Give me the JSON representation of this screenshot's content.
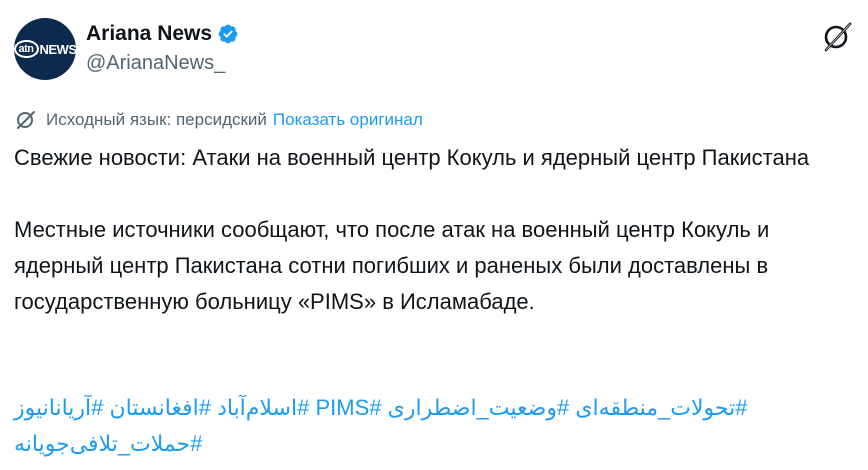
{
  "account": {
    "display_name": "Ariana News",
    "handle": "@ArianaNews_",
    "avatar_text": "NEWS",
    "avatar_ring": "atn"
  },
  "icons": {
    "verified": "verified-badge-icon",
    "grok": "grok-icon",
    "translate": "translate-icon"
  },
  "translation": {
    "source_label": "Исходный язык: персидский",
    "show_original": "Показать оригинал"
  },
  "tweet": {
    "headline": "Свежие новости: Атаки на военный центр Кокуль и ядерный центр Пакистана",
    "body": "Местные источники сообщают, что после атак на военный центр Кокуль и ядерный центр Пакистана сотни погибших и раненых были доставлены в государственную больницу «PIMS» в Исламабаде.",
    "hashtags": [
      "#تحولات_منطقه‌ای",
      "#وضعیت_اضطراری",
      "#PIMS",
      "#اسلام‌آباد",
      "#افغانستان",
      "#آریانانیوز",
      "#حملات_تلافی‌جویانه"
    ]
  },
  "colors": {
    "accent": "#1d9bf0",
    "secondary_text": "#536471",
    "primary_text": "#0f1419"
  }
}
